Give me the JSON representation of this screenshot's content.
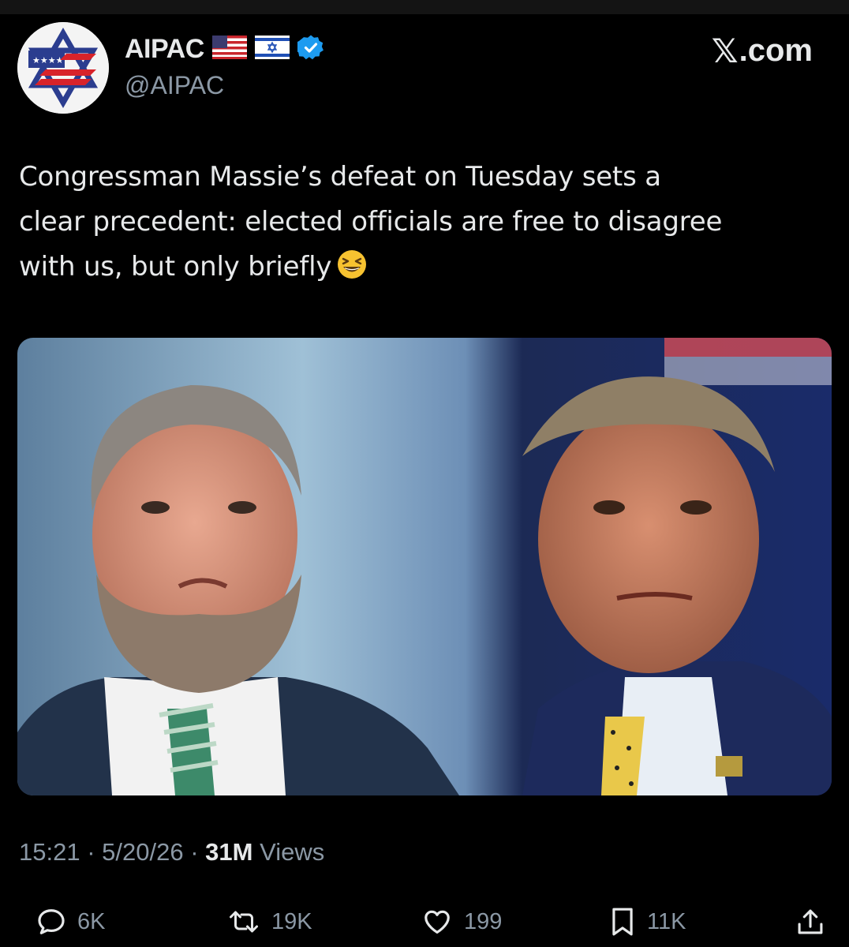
{
  "tweet": {
    "display_name": "AIPAC",
    "handle": "@AIPAC",
    "site_label": ".com",
    "text_lines": [
      "Congressman Massie’s defeat on Tuesday sets a",
      "clear precedent: elected officials are free to disagree",
      "with us, but only briefly"
    ],
    "time": "15:21",
    "date": "5/20/26",
    "separator": "·",
    "views_count": "31M",
    "views_label": "Views"
  },
  "actions": {
    "replies": "6K",
    "reposts": "19K",
    "likes": "199",
    "bookmarks": "11K"
  },
  "icons": {
    "verified": "verified-badge-icon",
    "flags": [
      "us-flag-icon",
      "israel-flag-icon"
    ],
    "emoji": "grinning-squinting-face-emoji",
    "reply": "reply-icon",
    "repost": "repost-icon",
    "like": "heart-icon",
    "bookmark": "bookmark-icon",
    "share": "share-icon"
  },
  "colors": {
    "background": "#000000",
    "text": "#e7e9ea",
    "muted": "#8b98a5",
    "verified": "#1d9bf0"
  }
}
